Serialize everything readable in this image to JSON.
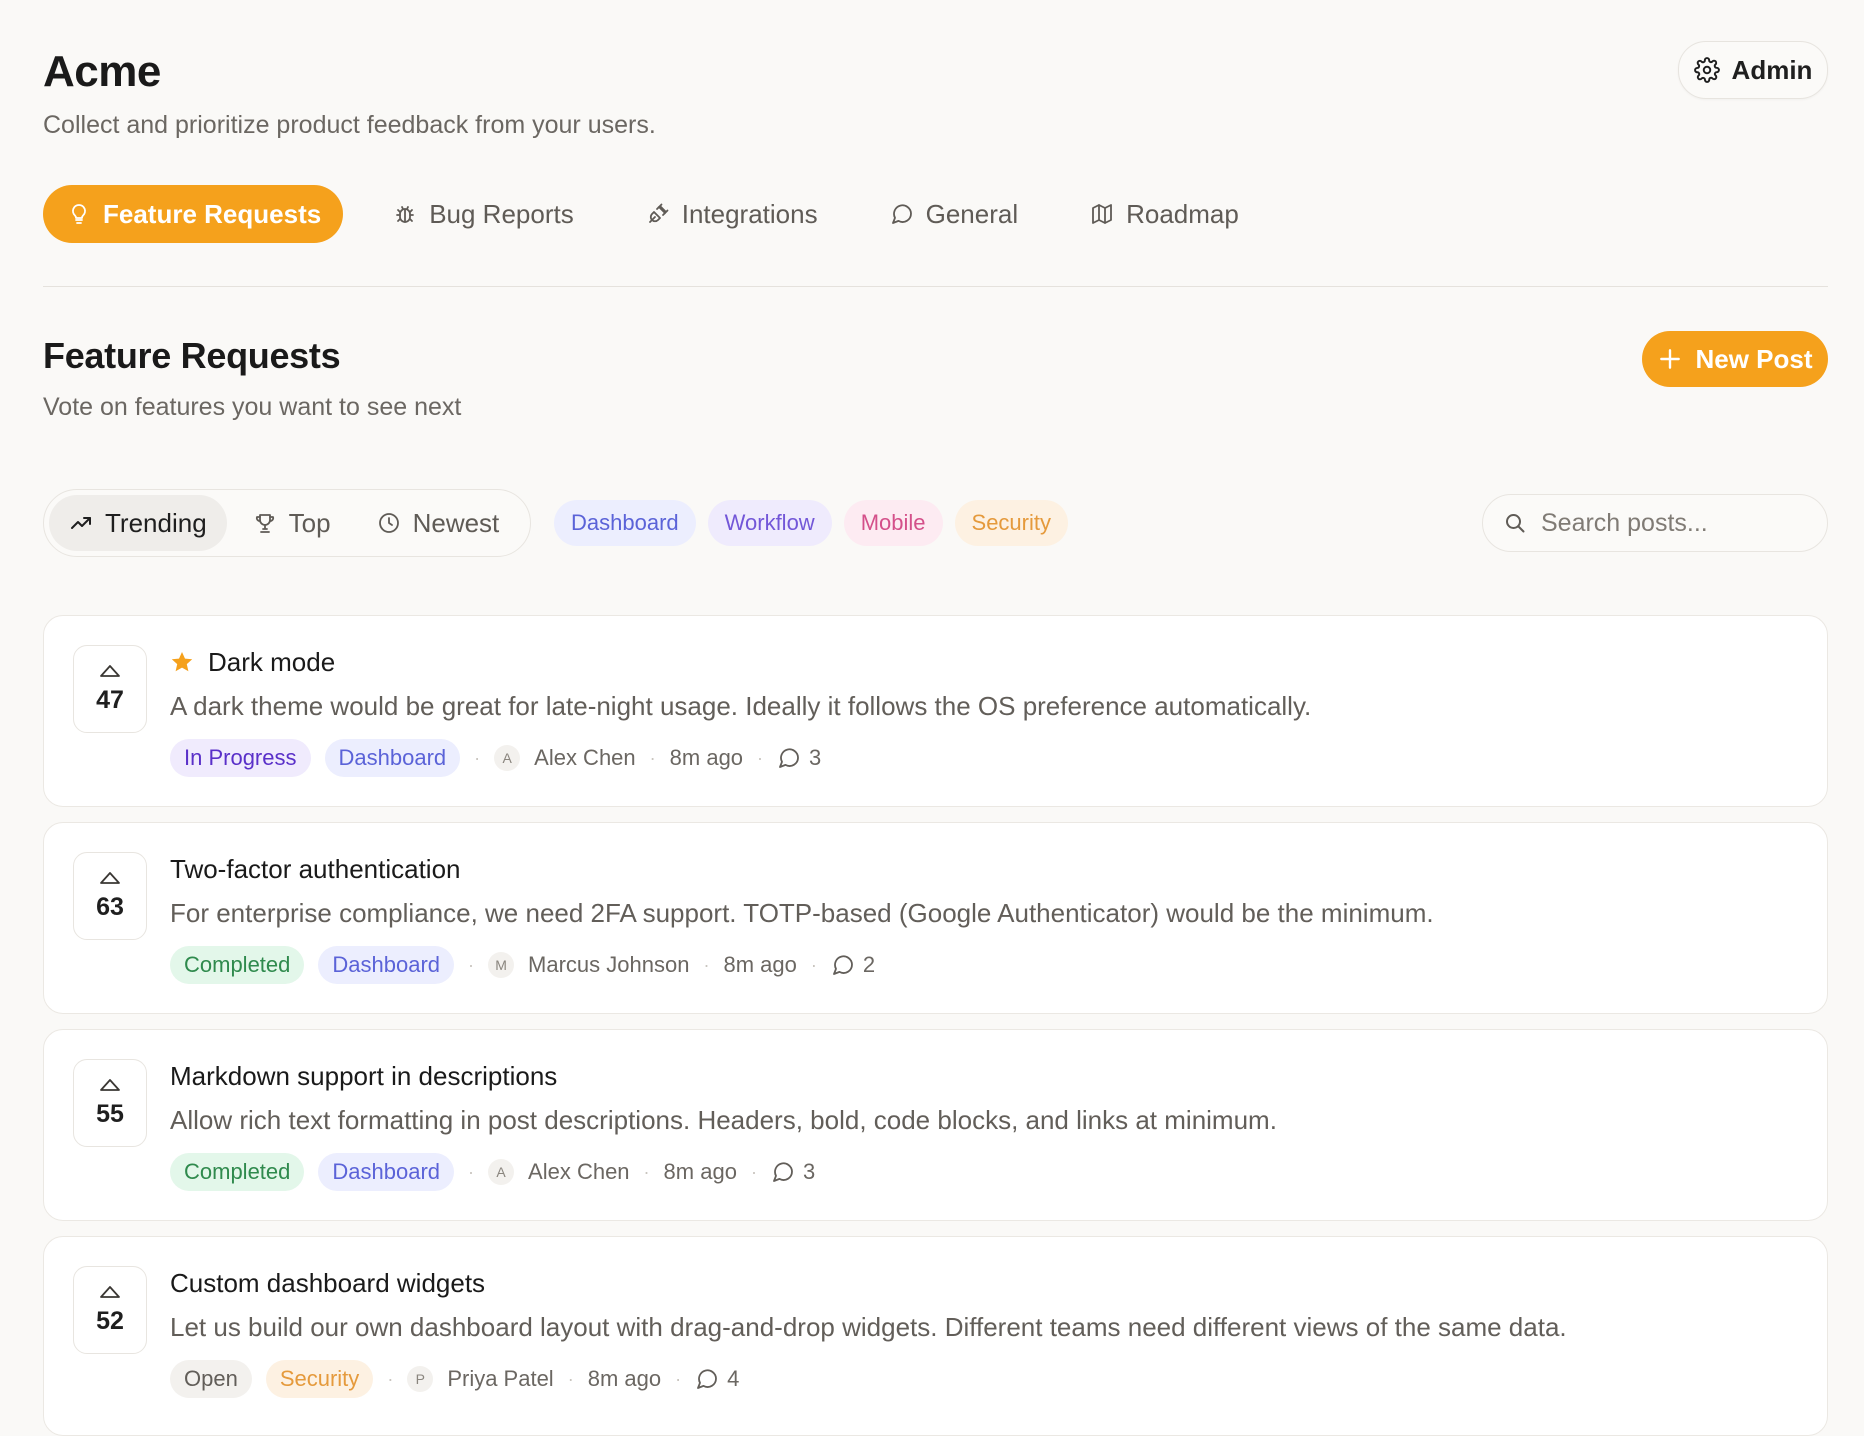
{
  "header": {
    "title": "Acme",
    "subtitle": "Collect and prioritize product feedback from your users.",
    "admin_label": "Admin"
  },
  "tabs": [
    {
      "label": "Feature Requests",
      "icon": "lightbulb-icon",
      "active": true
    },
    {
      "label": "Bug Reports",
      "icon": "bug-icon"
    },
    {
      "label": "Integrations",
      "icon": "plug-icon"
    },
    {
      "label": "General",
      "icon": "chat-bubble-icon"
    },
    {
      "label": "Roadmap",
      "icon": "map-icon"
    }
  ],
  "section": {
    "title": "Feature Requests",
    "subtitle": "Vote on features you want to see next",
    "new_post_label": "New Post"
  },
  "sort": [
    {
      "label": "Trending",
      "icon": "trending-icon",
      "active": true
    },
    {
      "label": "Top",
      "icon": "trophy-icon"
    },
    {
      "label": "Newest",
      "icon": "clock-icon"
    }
  ],
  "category_filters": [
    "Dashboard",
    "Workflow",
    "Mobile",
    "Security"
  ],
  "search": {
    "placeholder": "Search posts..."
  },
  "colors": {
    "accent": "#f5a11c",
    "background": "#faf9f7"
  },
  "posts": [
    {
      "votes": "47",
      "title": "Dark mode",
      "pinned": true,
      "description": "A dark theme would be great for late-night usage. Ideally it follows the OS preference automatically.",
      "status": "In Progress",
      "category": "Dashboard",
      "author_initial": "A",
      "author": "Alex Chen",
      "time": "8m ago",
      "comments": "3"
    },
    {
      "votes": "63",
      "title": "Two-factor authentication",
      "pinned": false,
      "description": "For enterprise compliance, we need 2FA support. TOTP-based (Google Authenticator) would be the minimum.",
      "status": "Completed",
      "category": "Dashboard",
      "author_initial": "M",
      "author": "Marcus Johnson",
      "time": "8m ago",
      "comments": "2"
    },
    {
      "votes": "55",
      "title": "Markdown support in descriptions",
      "pinned": false,
      "description": "Allow rich text formatting in post descriptions. Headers, bold, code blocks, and links at minimum.",
      "status": "Completed",
      "category": "Dashboard",
      "author_initial": "A",
      "author": "Alex Chen",
      "time": "8m ago",
      "comments": "3"
    },
    {
      "votes": "52",
      "title": "Custom dashboard widgets",
      "pinned": false,
      "description": "Let us build our own dashboard layout with drag-and-drop widgets. Different teams need different views of the same data.",
      "status": "Open",
      "category": "Security",
      "author_initial": "P",
      "author": "Priya Patel",
      "time": "8m ago",
      "comments": "4"
    }
  ]
}
